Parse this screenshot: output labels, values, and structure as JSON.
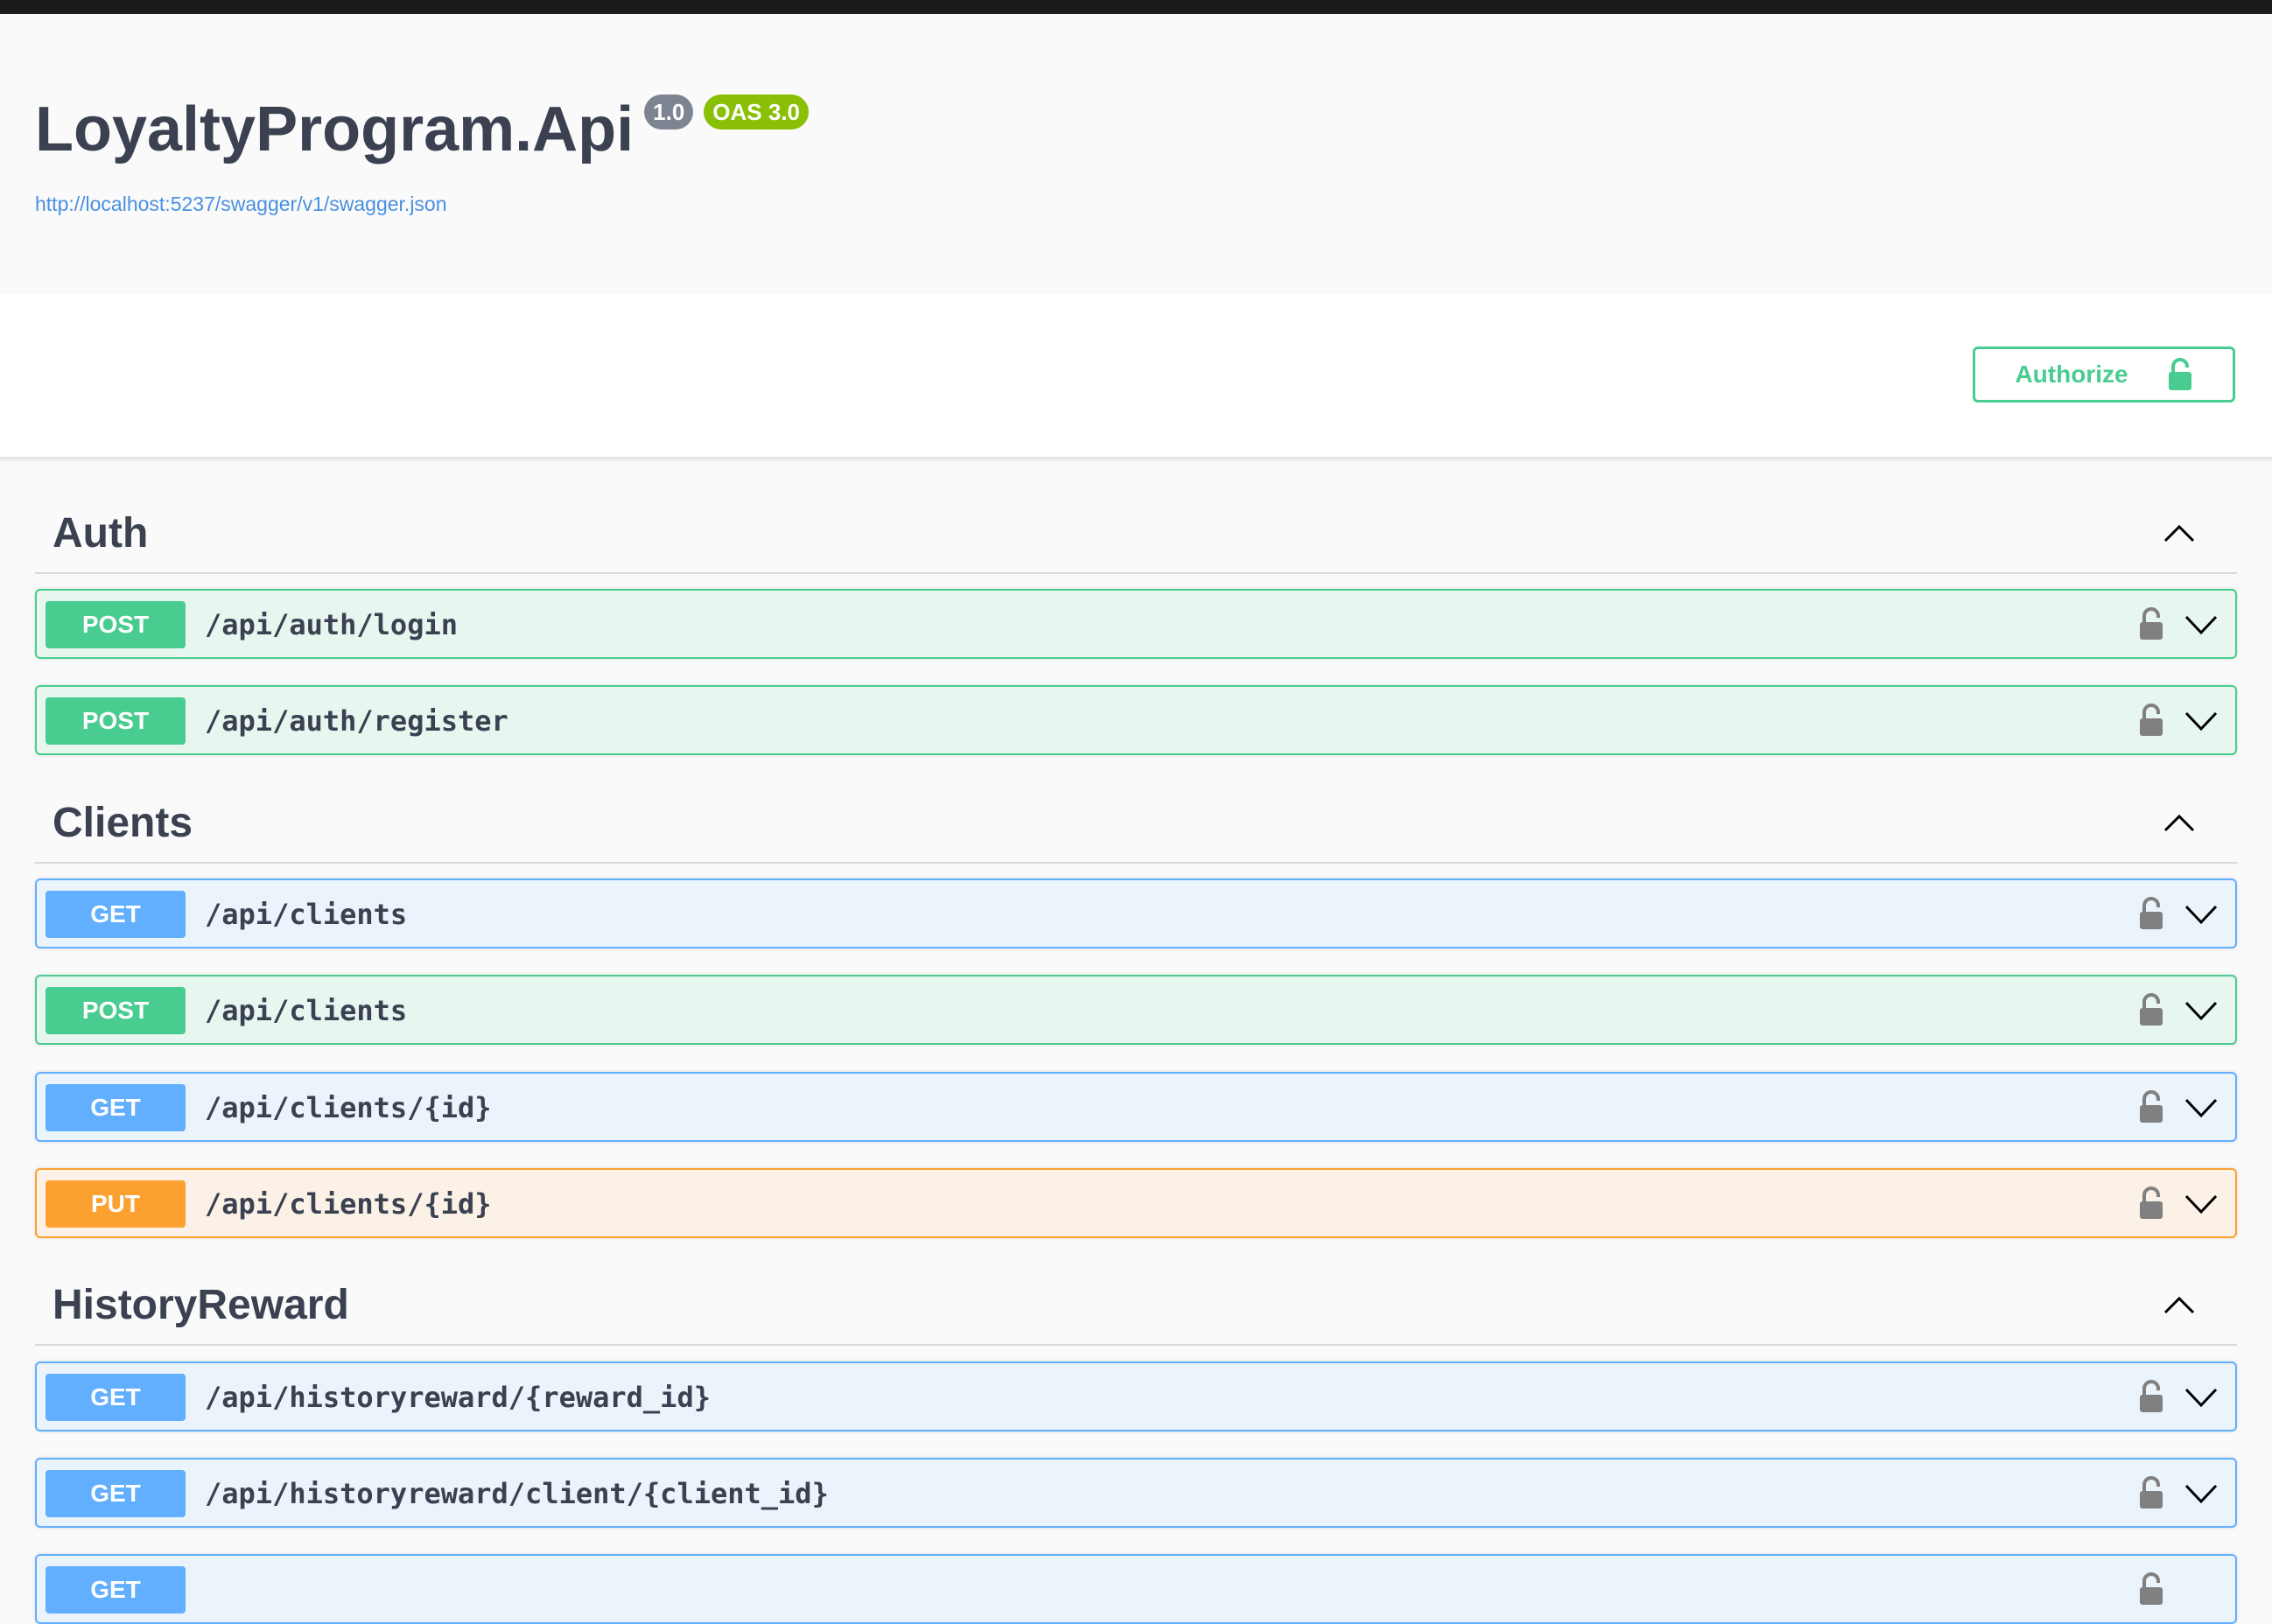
{
  "info": {
    "title": "LoyaltyProgram.Api",
    "version": "1.0",
    "oas": "OAS 3.0",
    "spec_url": "http://localhost:5237/swagger/v1/swagger.json"
  },
  "authorize": {
    "label": "Authorize",
    "icon": "unlocked-lock-icon"
  },
  "tags": [
    {
      "name": "Auth",
      "operations": [
        {
          "method": "POST",
          "path": "/api/auth/login"
        },
        {
          "method": "POST",
          "path": "/api/auth/register"
        }
      ]
    },
    {
      "name": "Clients",
      "operations": [
        {
          "method": "GET",
          "path": "/api/clients"
        },
        {
          "method": "POST",
          "path": "/api/clients"
        },
        {
          "method": "GET",
          "path": "/api/clients/{id}"
        },
        {
          "method": "PUT",
          "path": "/api/clients/{id}"
        }
      ]
    },
    {
      "name": "HistoryReward",
      "operations": [
        {
          "method": "GET",
          "path": "/api/historyreward/{reward_id}"
        },
        {
          "method": "GET",
          "path": "/api/historyreward/client/{client_id}"
        },
        {
          "method": "GET",
          "path": ""
        }
      ]
    }
  ],
  "colors": {
    "post": "#49cc90",
    "get": "#61affe",
    "put": "#fca130",
    "link": "#4990e2",
    "version_badge": "#7d8492",
    "oas_badge": "#89bf04"
  }
}
